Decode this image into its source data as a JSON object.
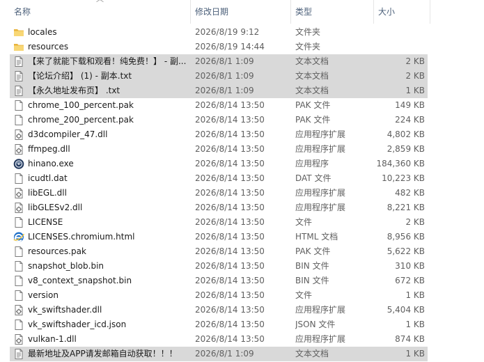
{
  "columns": {
    "name": "名称",
    "date": "修改日期",
    "type": "类型",
    "size": "大小"
  },
  "files": [
    {
      "name": "locales",
      "date": "2026/8/19 9:12",
      "type": "文件夹",
      "size": "",
      "icon": "folder",
      "selected": false
    },
    {
      "name": "resources",
      "date": "2026/8/19 14:44",
      "type": "文件夹",
      "size": "",
      "icon": "folder",
      "selected": false
    },
    {
      "name": "【来了就能下载和观看！纯免费！】 - 副...",
      "date": "2026/8/1 1:09",
      "type": "文本文档",
      "size": "2 KB",
      "icon": "text",
      "selected": true
    },
    {
      "name": "【论坛介绍】 (1) - 副本.txt",
      "date": "2026/8/1 1:09",
      "type": "文本文档",
      "size": "2 KB",
      "icon": "text",
      "selected": true
    },
    {
      "name": "【永久地址发布页】 .txt",
      "date": "2026/8/1 1:09",
      "type": "文本文档",
      "size": "1 KB",
      "icon": "text",
      "selected": true
    },
    {
      "name": "chrome_100_percent.pak",
      "date": "2026/8/14 13:50",
      "type": "PAK 文件",
      "size": "149 KB",
      "icon": "file",
      "selected": false
    },
    {
      "name": "chrome_200_percent.pak",
      "date": "2026/8/14 13:50",
      "type": "PAK 文件",
      "size": "224 KB",
      "icon": "file",
      "selected": false
    },
    {
      "name": "d3dcompiler_47.dll",
      "date": "2026/8/14 13:50",
      "type": "应用程序扩展",
      "size": "4,802 KB",
      "icon": "dll",
      "selected": false
    },
    {
      "name": "ffmpeg.dll",
      "date": "2026/8/14 13:50",
      "type": "应用程序扩展",
      "size": "2,859 KB",
      "icon": "dll",
      "selected": false
    },
    {
      "name": "hinano.exe",
      "date": "2026/8/14 13:50",
      "type": "应用程序",
      "size": "184,360 KB",
      "icon": "exe",
      "selected": false
    },
    {
      "name": "icudtl.dat",
      "date": "2026/8/14 13:50",
      "type": "DAT 文件",
      "size": "10,223 KB",
      "icon": "file",
      "selected": false
    },
    {
      "name": "libEGL.dll",
      "date": "2026/8/14 13:50",
      "type": "应用程序扩展",
      "size": "482 KB",
      "icon": "dll",
      "selected": false
    },
    {
      "name": "libGLESv2.dll",
      "date": "2026/8/14 13:50",
      "type": "应用程序扩展",
      "size": "8,221 KB",
      "icon": "dll",
      "selected": false
    },
    {
      "name": "LICENSE",
      "date": "2026/8/14 13:50",
      "type": "文件",
      "size": "2 KB",
      "icon": "file",
      "selected": false
    },
    {
      "name": "LICENSES.chromium.html",
      "date": "2026/8/14 13:50",
      "type": "HTML 文档",
      "size": "8,956 KB",
      "icon": "html",
      "selected": false
    },
    {
      "name": "resources.pak",
      "date": "2026/8/14 13:50",
      "type": "PAK 文件",
      "size": "5,622 KB",
      "icon": "file",
      "selected": false
    },
    {
      "name": "snapshot_blob.bin",
      "date": "2026/8/14 13:50",
      "type": "BIN 文件",
      "size": "310 KB",
      "icon": "file",
      "selected": false
    },
    {
      "name": "v8_context_snapshot.bin",
      "date": "2026/8/14 13:50",
      "type": "BIN 文件",
      "size": "672 KB",
      "icon": "file",
      "selected": false
    },
    {
      "name": "version",
      "date": "2026/8/14 13:50",
      "type": "文件",
      "size": "1 KB",
      "icon": "file",
      "selected": false
    },
    {
      "name": "vk_swiftshader.dll",
      "date": "2026/8/14 13:50",
      "type": "应用程序扩展",
      "size": "5,404 KB",
      "icon": "dll",
      "selected": false
    },
    {
      "name": "vk_swiftshader_icd.json",
      "date": "2026/8/14 13:50",
      "type": "JSON 文件",
      "size": "1 KB",
      "icon": "file",
      "selected": false
    },
    {
      "name": "vulkan-1.dll",
      "date": "2026/8/14 13:50",
      "type": "应用程序扩展",
      "size": "874 KB",
      "icon": "dll",
      "selected": false
    },
    {
      "name": "最新地址及APP请发邮箱自动获取！！！",
      "date": "2026/8/1 1:09",
      "type": "文本文档",
      "size": "1 KB",
      "icon": "text",
      "selected": true
    }
  ]
}
